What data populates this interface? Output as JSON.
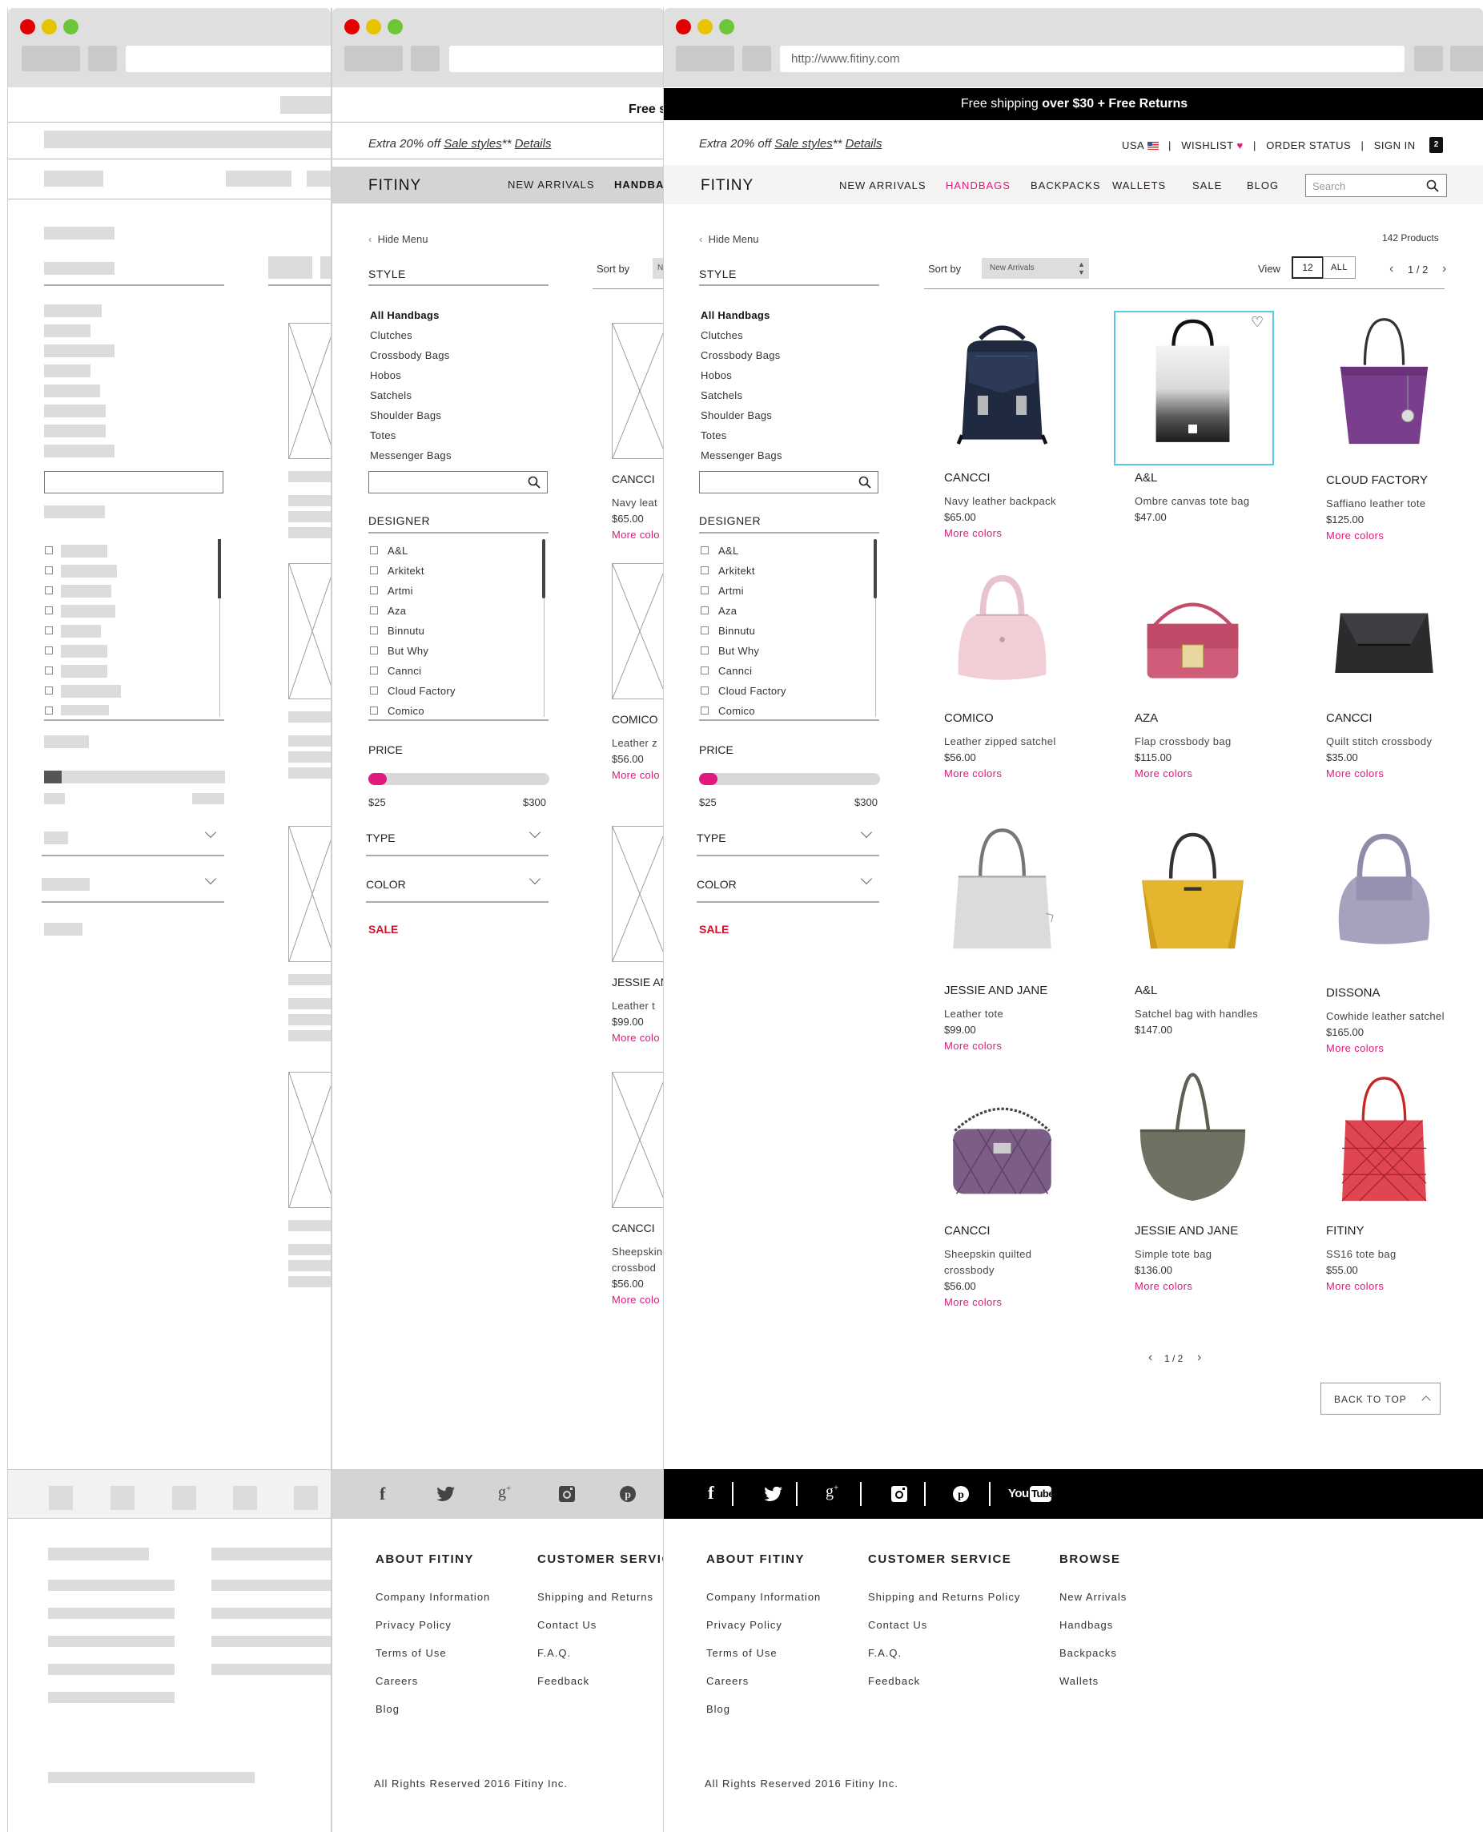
{
  "browser": {
    "url": "http://www.fitiny.com"
  },
  "top_bar": {
    "text_pre": "Free shipping ",
    "text_bold": "over $30 + Free Returns",
    "text_cut": "Free s"
  },
  "promo": {
    "text": "Extra 20% off ",
    "link1": "Sale styles",
    "stars": "**",
    "link2": "Details"
  },
  "header": {
    "logo": "FITINY",
    "nav": [
      "NEW ARRIVALS",
      "HANDBAGS",
      "BACKPACKS",
      "WALLETS",
      "SALE",
      "BLOG"
    ],
    "nav_cut": "HANDBA",
    "active_nav": "HANDBAGS",
    "util": {
      "country": "USA",
      "wishlist": "WISHLIST",
      "order_status": "ORDER STATUS",
      "sign_in": "SIGN IN",
      "cart_count": "2"
    },
    "search_placeholder": "Search"
  },
  "sidebar": {
    "hide_menu": "Hide Menu",
    "style_title": "STYLE",
    "styles": [
      "All Handbags",
      "Clutches",
      "Crossbody Bags",
      "Hobos",
      "Satchels",
      "Shoulder Bags",
      "Totes",
      "Messenger Bags"
    ],
    "designer_title": "DESIGNER",
    "designers": [
      "A&L",
      "Arkitekt",
      "Artmi",
      "Aza",
      "Binnutu",
      "But Why",
      "Cannci",
      "Cloud Factory",
      "Comico"
    ],
    "price_title": "PRICE",
    "price_min": "$25",
    "price_max": "$300",
    "price_fill_fraction": 0.1,
    "type_title": "TYPE",
    "color_title": "COLOR",
    "sale": "SALE"
  },
  "toolbar": {
    "sort_label": "Sort by",
    "sort_value": "New Arrivals",
    "sort_cut": "Ne",
    "product_count": "142 Products",
    "view_label": "View",
    "view_12": "12",
    "view_all": "ALL",
    "page": "1 / 2"
  },
  "products": [
    {
      "brand": "CANCCI",
      "name": "Navy leather backpack",
      "price": "$65.00",
      "more": "More colors",
      "name_cut": "Navy leat",
      "more_cut": "More colo"
    },
    {
      "brand": "A&L",
      "name": "Ombre canvas tote bag",
      "price": "$47.00"
    },
    {
      "brand": "CLOUD FACTORY",
      "name": "Saffiano leather tote",
      "price": "$125.00",
      "more": "More colors"
    },
    {
      "brand": "COMICO",
      "name": "Leather zipped satchel",
      "price": "$56.00",
      "more": "More colors",
      "name_cut": "Leather z",
      "more_cut": "More colo"
    },
    {
      "brand": "AZA",
      "name": "Flap crossbody bag",
      "price": "$115.00",
      "more": "More colors"
    },
    {
      "brand": "CANCCI",
      "name": "Quilt stitch crossbody",
      "price": "$35.00",
      "more": "More colors"
    },
    {
      "brand": "JESSIE AND JANE",
      "name": "Leather tote",
      "price": "$99.00",
      "more": "More colors",
      "brand_cut": "JESSIE AND",
      "name_cut": "Leather t",
      "more_cut": "More colo"
    },
    {
      "brand": "A&L",
      "name": "Satchel bag with handles",
      "price": "$147.00"
    },
    {
      "brand": "DISSONA",
      "name": "Cowhide leather satchel",
      "price": "$165.00",
      "more": "More colors"
    },
    {
      "brand": "CANCCI",
      "name": "Sheepskin quilted",
      "name2": "crossbody",
      "price": "$56.00",
      "more": "More colors",
      "name_cut": "Sheepskin",
      "name2_cut": "crossbod",
      "more_cut": "More colo"
    },
    {
      "brand": "JESSIE AND JANE",
      "name": "Simple tote bag",
      "price": "$136.00",
      "more": "More colors"
    },
    {
      "brand": "FITINY",
      "name": "SS16 tote bag",
      "price": "$55.00",
      "more": "More colors"
    }
  ],
  "pagination": {
    "page": "1 / 2"
  },
  "back_to_top": "BACK TO TOP",
  "social": [
    "facebook",
    "twitter",
    "google-plus",
    "instagram",
    "pinterest",
    "youtube"
  ],
  "footer": {
    "about": {
      "title": "ABOUT FITINY",
      "links": [
        "Company Information",
        "Privacy Policy",
        "Terms of Use",
        "Careers",
        "Blog"
      ]
    },
    "service": {
      "title": "CUSTOMER SERVICE",
      "title_cut": "CUSTOMER SERVIC",
      "links": [
        "Shipping and Returns Policy",
        "Contact Us",
        "F.A.Q.",
        "Feedback"
      ],
      "shipping_cut": "Shipping and Returns"
    },
    "browse": {
      "title": "BROWSE",
      "links": [
        "New Arrivals",
        "Handbags",
        "Backpacks",
        "Wallets"
      ]
    },
    "copyright": "All Rights Reserved 2016 Fitiny Inc."
  },
  "colors": {
    "accent": "#e0197d",
    "sale": "#d40f2c",
    "hover_border": "#5bc8e6",
    "footer_bar": "#000000",
    "skeleton": "#dcdcdc"
  }
}
